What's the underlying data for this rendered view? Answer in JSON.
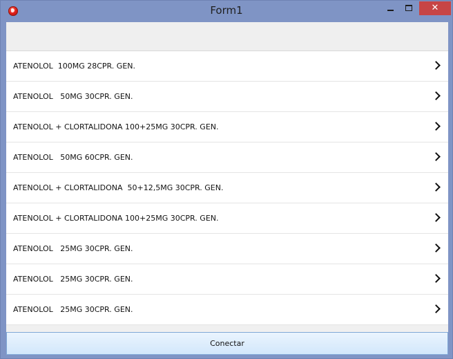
{
  "window": {
    "title": "Form1",
    "close_glyph": "✕"
  },
  "list": {
    "items": [
      {
        "label": "ATENOLOL  100MG 28CPR. GEN."
      },
      {
        "label": "ATENOLOL   50MG 30CPR. GEN."
      },
      {
        "label": "ATENOLOL + CLORTALIDONA 100+25MG 30CPR. GEN."
      },
      {
        "label": "ATENOLOL   50MG 60CPR. GEN."
      },
      {
        "label": "ATENOLOL + CLORTALIDONA  50+12,5MG 30CPR. GEN."
      },
      {
        "label": "ATENOLOL + CLORTALIDONA 100+25MG 30CPR. GEN."
      },
      {
        "label": "ATENOLOL   25MG 30CPR. GEN."
      },
      {
        "label": "ATENOLOL   25MG 30CPR. GEN."
      },
      {
        "label": "ATENOLOL   25MG 30CPR. GEN."
      }
    ]
  },
  "footer": {
    "connect_label": "Conectar"
  },
  "colors": {
    "titlebar": "#7f94c5",
    "close_button": "#c74545",
    "button_border": "#7fa7d6"
  }
}
